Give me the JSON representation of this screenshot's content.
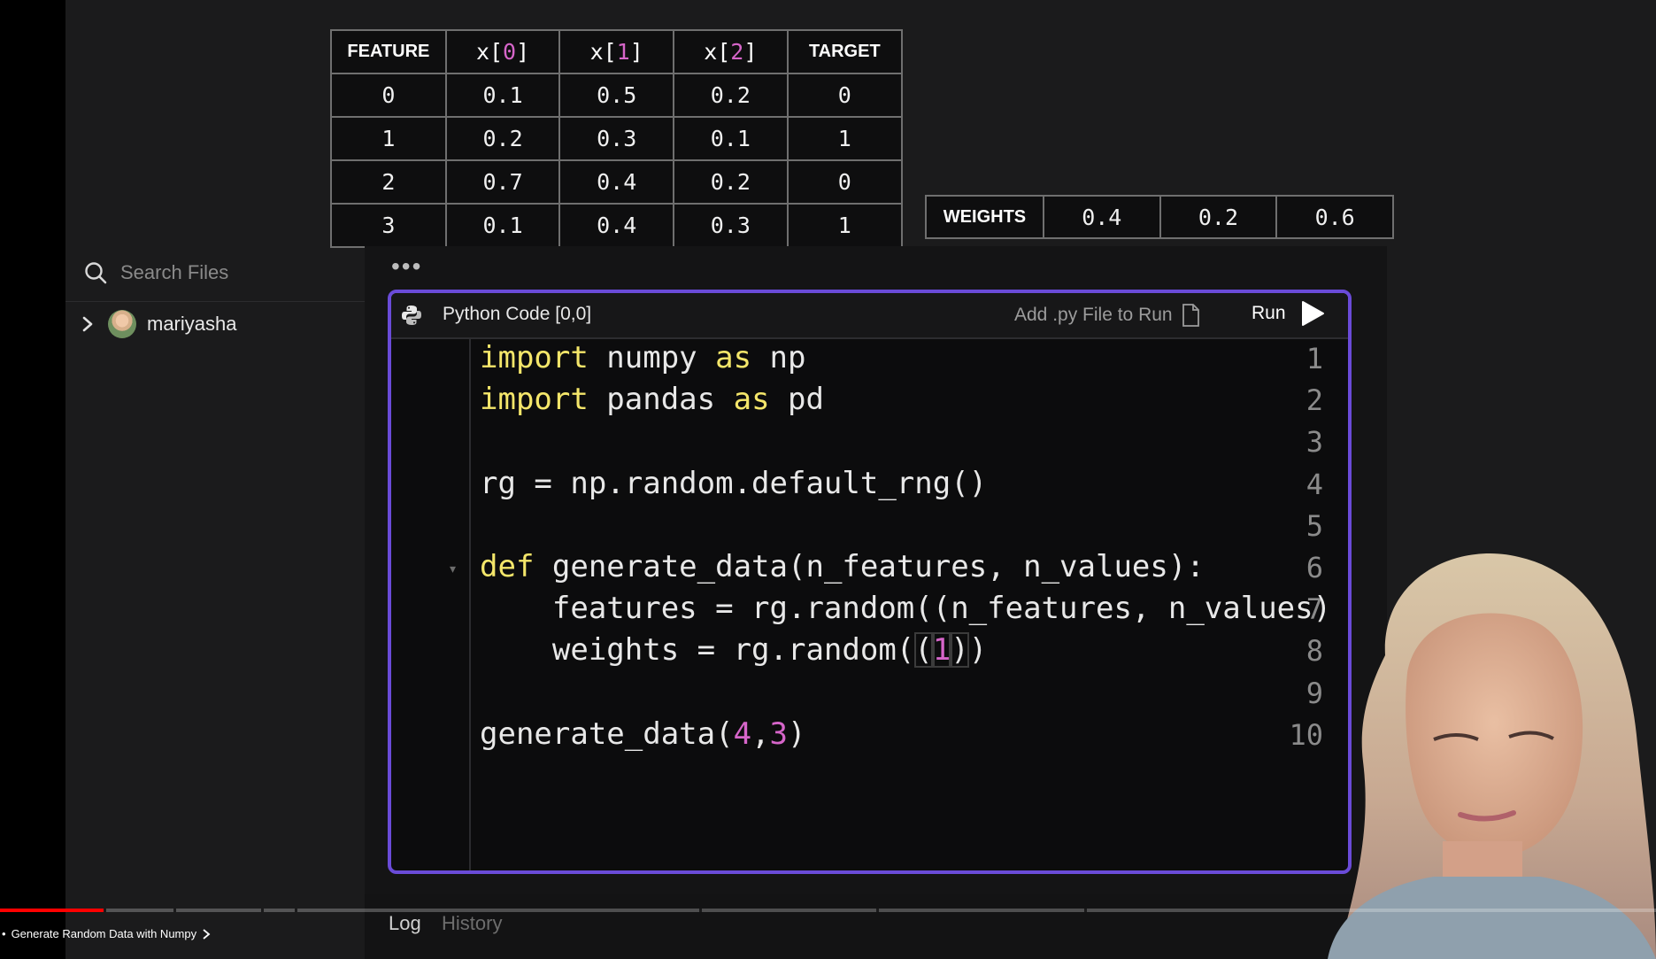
{
  "features_table": {
    "headers": [
      {
        "pre": "FEATURE",
        "idx": "",
        "post": ""
      },
      {
        "pre": "x[",
        "idx": "0",
        "post": "]"
      },
      {
        "pre": "x[",
        "idx": "1",
        "post": "]"
      },
      {
        "pre": "x[",
        "idx": "2",
        "post": "]"
      },
      {
        "pre": "TARGET",
        "idx": "",
        "post": ""
      }
    ],
    "rows": [
      {
        "feature": "0",
        "x0": "0.1",
        "x1": "0.5",
        "x2": "0.2",
        "target": "0"
      },
      {
        "feature": "1",
        "x0": "0.2",
        "x1": "0.3",
        "x2": "0.1",
        "target": "1"
      },
      {
        "feature": "2",
        "x0": "0.7",
        "x1": "0.4",
        "x2": "0.2",
        "target": "0"
      },
      {
        "feature": "3",
        "x0": "0.1",
        "x1": "0.4",
        "x2": "0.3",
        "target": "1"
      }
    ]
  },
  "weights_table": {
    "label": "WEIGHTS",
    "values": [
      "0.4",
      "0.2",
      "0.6"
    ]
  },
  "sidebar": {
    "search_placeholder": "Search Files",
    "user": "mariyasha",
    "icons": {
      "search": "search-icon",
      "chevron": "chevron-right-icon",
      "avatar": "avatar"
    }
  },
  "editor": {
    "dots": "•••",
    "title": "Python Code [0,0]",
    "add_file": "Add .py File to Run",
    "run": "Run",
    "icons": {
      "python": "python-icon",
      "file": "file-icon",
      "play": "play-icon"
    },
    "line_numbers": [
      "1",
      "2",
      "3",
      "4",
      "5",
      "6",
      "7",
      "8",
      "9",
      "10"
    ],
    "lines": [
      [
        {
          "t": "import",
          "c": "kw"
        },
        {
          "t": " numpy ",
          "c": ""
        },
        {
          "t": "as",
          "c": "kw"
        },
        {
          "t": " np",
          "c": ""
        }
      ],
      [
        {
          "t": "import",
          "c": "kw"
        },
        {
          "t": " pandas ",
          "c": ""
        },
        {
          "t": "as",
          "c": "kw"
        },
        {
          "t": " pd",
          "c": ""
        }
      ],
      [],
      [
        {
          "t": "rg = np.random.default_rng()",
          "c": ""
        }
      ],
      [],
      [
        {
          "t": "def",
          "c": "kw"
        },
        {
          "t": " generate_data(n_features, n_values):",
          "c": ""
        }
      ],
      [
        {
          "t": "    features = rg.random((n_features, n_values)",
          "c": ""
        }
      ],
      [
        {
          "t": "    weights = rg.random(",
          "c": ""
        },
        {
          "t": "(",
          "c": "br"
        },
        {
          "t": "1",
          "c": "num br"
        },
        {
          "t": ")",
          "c": "br"
        },
        {
          "t": ")",
          "c": ""
        }
      ],
      [],
      [
        {
          "t": "generate_data(",
          "c": ""
        },
        {
          "t": "4",
          "c": "num"
        },
        {
          "t": ",",
          "c": ""
        },
        {
          "t": "3",
          "c": "num"
        },
        {
          "t": ")",
          "c": ""
        }
      ]
    ]
  },
  "bottom_tabs": {
    "log": "Log",
    "history": "History"
  },
  "video": {
    "chapter": "Generate Random Data with Numpy",
    "chapter_prefix": "•",
    "progress_fraction": 0.063,
    "accent": "#ff0000"
  },
  "colors": {
    "panel_border": "#6a4bd8",
    "keyword": "#f4e66a",
    "number": "#d665c9",
    "weights": "#86e69c",
    "table_values": "#f1ec59"
  }
}
